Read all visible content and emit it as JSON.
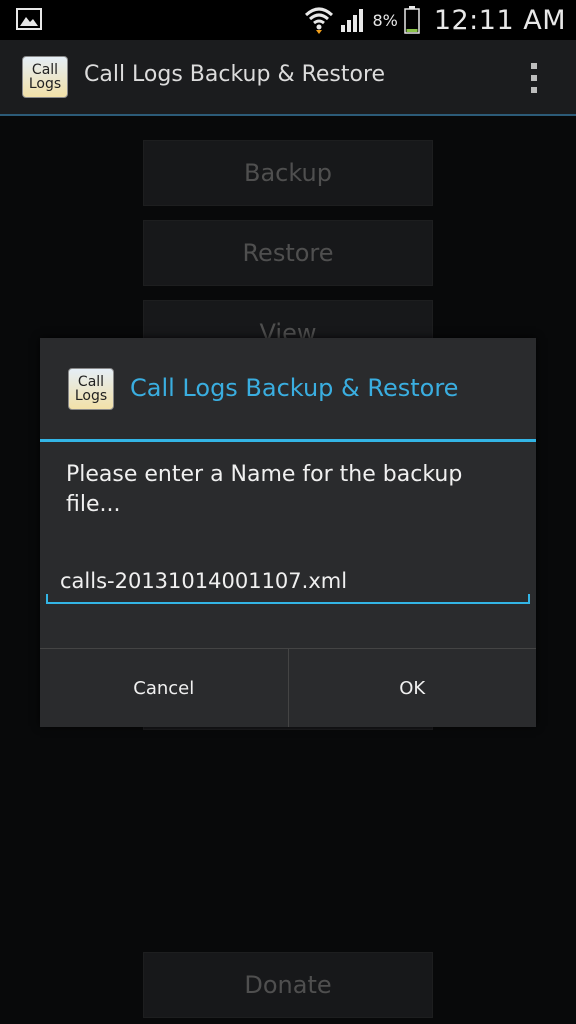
{
  "status_bar": {
    "battery_percent": "8%",
    "time": "12:11 AM"
  },
  "action_bar": {
    "app_icon_line1": "Call",
    "app_icon_line2": "Logs",
    "title": "Call Logs Backup & Restore"
  },
  "main_buttons": {
    "backup": "Backup",
    "restore": "Restore",
    "view": "View",
    "donate": "Donate"
  },
  "dialog": {
    "icon_line1": "Call",
    "icon_line2": "Logs",
    "title": "Call Logs Backup & Restore",
    "message": "Please enter a Name for the backup file...",
    "input_value": "calls-20131014001107.xml",
    "cancel_label": "Cancel",
    "ok_label": "OK"
  },
  "colors": {
    "accent": "#33b5e5",
    "title_blue": "#3aaee0",
    "battery_green": "#8bc34a"
  }
}
